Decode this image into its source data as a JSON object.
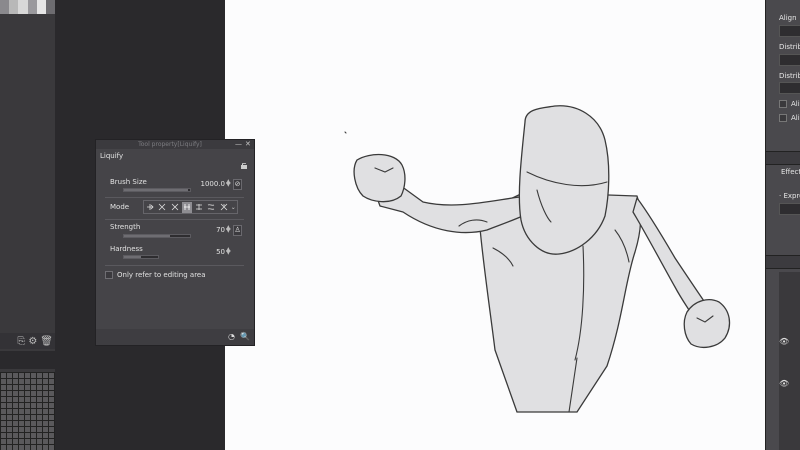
{
  "window": {
    "canvas_bg": "#fcfcfd",
    "sketch_color": "#3a3a3a",
    "figure_fill": "#e0e0e2"
  },
  "liquify": {
    "window_title": "Tool property[Liquify]",
    "heading": "Liquify",
    "brush_size": {
      "label": "Brush Size",
      "value": "1000.0",
      "level": 0.97
    },
    "mode": {
      "label": "Mode",
      "options": [
        "push",
        "expand",
        "pinch",
        "push-left",
        "push-right",
        "twist-left",
        "twist-right"
      ],
      "selected_index": 3
    },
    "strength": {
      "label": "Strength",
      "value": "70",
      "level": 0.7
    },
    "hardness": {
      "label": "Hardness",
      "value": "50",
      "level": 0.5
    },
    "editing_area": {
      "label": "Only refer to editing area",
      "checked": false
    }
  },
  "right_panel": {
    "align_label": "Align",
    "distribute_label": "Distribu",
    "distribute2_label": "Distribut",
    "align_check_1": "Alig",
    "align_check_2": "Alig",
    "effect_label": "Effect",
    "express_label": "· Expres"
  },
  "left_panel": {
    "swatches": [
      "#8a898d",
      "#b8b8b8",
      "#d8d8d8",
      "#9a999d",
      "#e6e6e6",
      "#6d6c70"
    ]
  }
}
